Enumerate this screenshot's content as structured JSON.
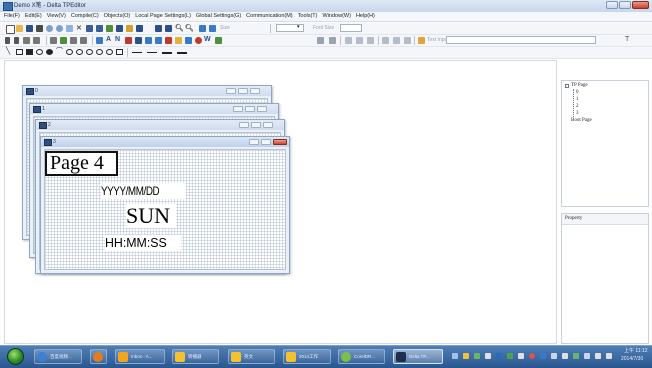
{
  "window": {
    "title": "Demo X笔 - Delta TPEditor"
  },
  "menubar": [
    "File(F)",
    "Edit(E)",
    "View(V)",
    "Compile(C)",
    "Objects(O)",
    "Local Page Settings(L)",
    "Global Settings(G)",
    "Communication(M)",
    "Tools(T)",
    "Window(W)",
    "Help(H)"
  ],
  "toolbar": {
    "size_label": "Size",
    "font_size_label": "Font Size",
    "text_input_label": "Text Input"
  },
  "pages": [
    {
      "caption": "0"
    },
    {
      "caption": "1"
    },
    {
      "caption": "2"
    },
    {
      "caption": "3"
    }
  ],
  "active_page": {
    "title": "Page 4",
    "date_format": "YYYY/MM/DD",
    "day_of_week": "SUN",
    "time_format": "HH:MM:SS"
  },
  "tree": {
    "root": "TP Page",
    "children": [
      "0",
      "1",
      "2",
      "3"
    ],
    "boot": "Boot Page"
  },
  "property_panel": {
    "label": "Property"
  },
  "taskbar": {
    "buttons": [
      {
        "label": "百度视频...",
        "icon_color": "#3d7fd0"
      },
      {
        "label": "",
        "icon_color": "#e37b1f"
      },
      {
        "label": "Inbox - A...",
        "icon_color": "#f0a420"
      },
      {
        "label": "转播器",
        "icon_color": "#f2c230"
      },
      {
        "label": "英文",
        "icon_color": "#f2c230"
      },
      {
        "label": "2014工作",
        "icon_color": "#f2c230"
      },
      {
        "label": "CorelDR...",
        "icon_color": "#7cc046"
      },
      {
        "label": "Delta TP...",
        "icon_color": "#1e2f4d"
      }
    ],
    "clock_time": "上午 11:12",
    "clock_date": "2014/7/30"
  },
  "colors": {
    "accent": "#2a568f",
    "close_red": "#c8412c"
  }
}
